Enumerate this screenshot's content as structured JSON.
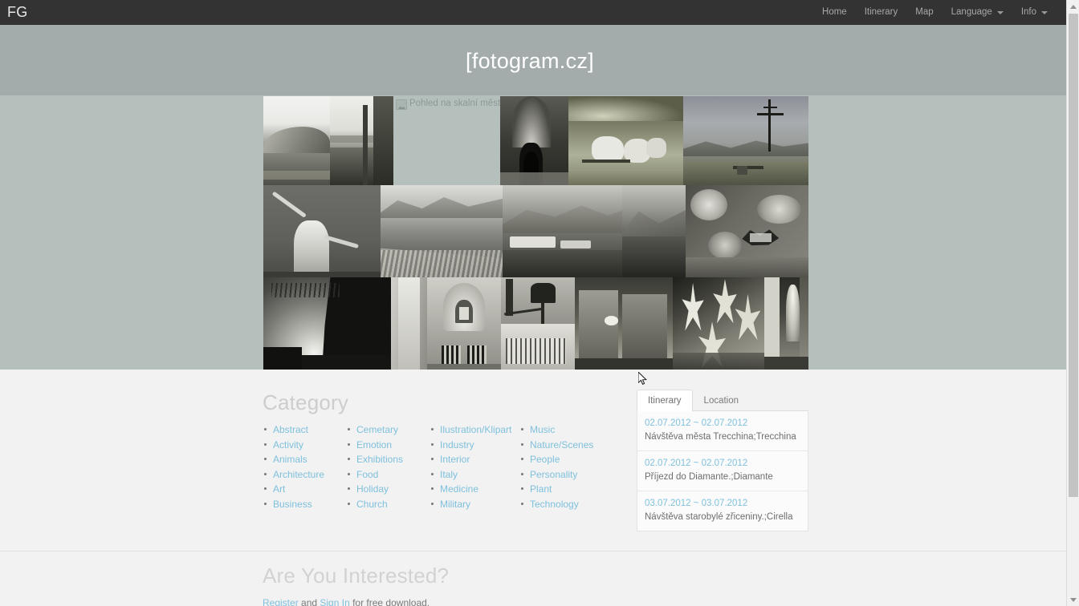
{
  "navbar": {
    "brand": "FG",
    "items": [
      {
        "label": "Home",
        "has_caret": false,
        "icon": ""
      },
      {
        "label": "Itinerary",
        "has_caret": false,
        "icon": ""
      },
      {
        "label": "Map",
        "has_caret": false,
        "icon": ""
      },
      {
        "label": "Language",
        "has_caret": true,
        "icon": "chevron-down-icon"
      },
      {
        "label": "Info",
        "has_caret": true,
        "icon": "chevron-down-icon"
      }
    ]
  },
  "hero": {
    "title": "[fotogram.cz]",
    "background_color": "#a3acab"
  },
  "gallery": {
    "background_color": "#b5bfbc",
    "broken_image_alt": "Pohled na skalní město.",
    "broken_icon": "broken-image-icon"
  },
  "category": {
    "heading": "Category",
    "columns": [
      {
        "items": [
          "Abstract",
          "Activity",
          "Animals",
          "Architecture",
          "Art",
          "Business"
        ]
      },
      {
        "items": [
          "Cemetary",
          "Emotion",
          "Exhibitions",
          "Food",
          "Holiday",
          "Church"
        ]
      },
      {
        "items": [
          "Ilustration/Klipart",
          "Industry",
          "Interior",
          "Italy",
          "Medicine",
          "Military"
        ]
      },
      {
        "items": [
          "Music",
          "Nature/Scenes",
          "People",
          "Personality",
          "Plant",
          "Technology"
        ]
      }
    ],
    "link_color": "#7fc0dd"
  },
  "itinerary_panel": {
    "tabs": [
      {
        "label": "Itinerary",
        "active": true
      },
      {
        "label": "Location",
        "active": false
      }
    ],
    "entries": [
      {
        "date": "02.07.2012 ~ 02.07.2012",
        "description": "Návštěva města Trecchina;Trecchina"
      },
      {
        "date": "02.07.2012 ~ 02.07.2012",
        "description": "Příjezd do Diamante.;Diamante"
      },
      {
        "date": "03.07.2012 ~ 03.07.2012",
        "description": "Návštěva starobylé zřiceniny.;Cirella"
      }
    ]
  },
  "interested": {
    "heading": "Are You Interested?",
    "register_label": "Register",
    "and_text": " and ",
    "signin_label": "Sign In",
    "tail_text": " for free download."
  },
  "scrollbar": {
    "up_icon": "scroll-up-arrow-icon",
    "down_icon": "scroll-down-arrow-icon",
    "thumb": "scrollbar-thumb"
  }
}
